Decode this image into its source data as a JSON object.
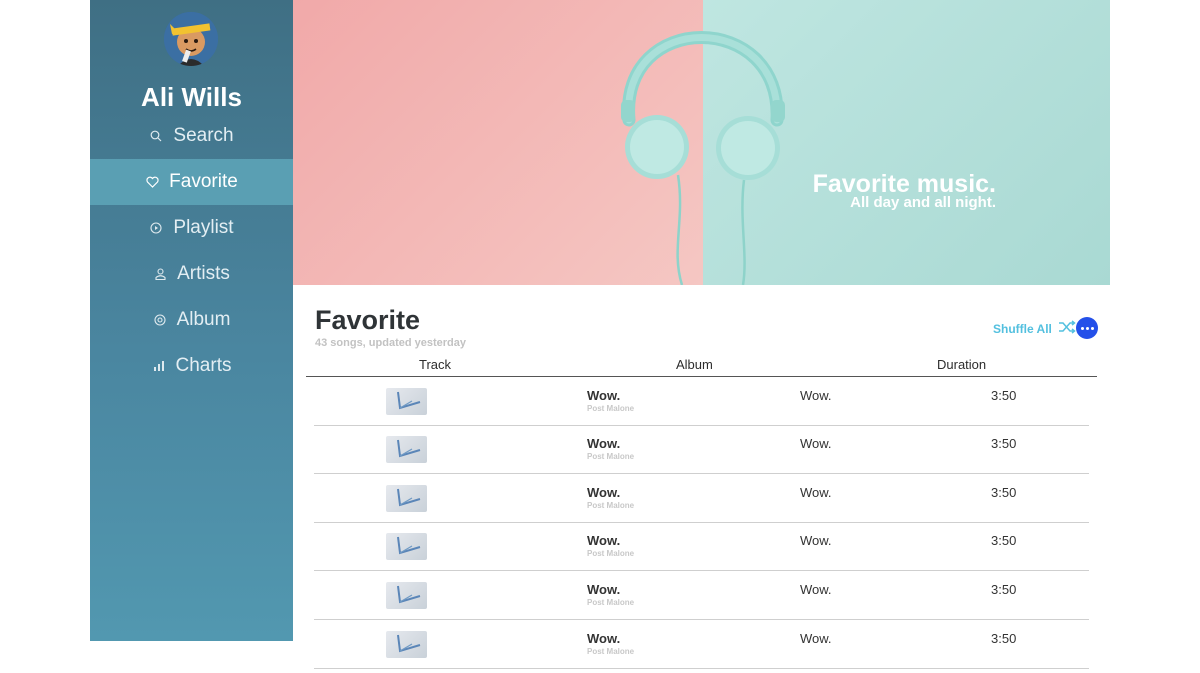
{
  "profile": {
    "name": "Ali Wills"
  },
  "nav": [
    {
      "label": "Search",
      "icon": "search-icon",
      "active": false
    },
    {
      "label": "Favorite",
      "icon": "heart-icon",
      "active": true
    },
    {
      "label": "Playlist",
      "icon": "play-circle-icon",
      "active": false
    },
    {
      "label": "Artists",
      "icon": "person-icon",
      "active": false
    },
    {
      "label": "Album",
      "icon": "disc-icon",
      "active": false
    },
    {
      "label": "Charts",
      "icon": "bar-chart-icon",
      "active": false
    }
  ],
  "hero": {
    "title": "Favorite music.",
    "subtitle": "All day and all night."
  },
  "section": {
    "title": "Favorite",
    "subtitle": "43 songs, updated yesterday"
  },
  "actions": {
    "shuffle_label": "Shuffle All"
  },
  "table": {
    "headers": {
      "track": "Track",
      "album": "Album",
      "duration": "Duration"
    },
    "rows": [
      {
        "title": "Wow.",
        "artist": "Post Malone",
        "album": "Wow.",
        "duration": "3:50"
      },
      {
        "title": "Wow.",
        "artist": "Post Malone",
        "album": "Wow.",
        "duration": "3:50"
      },
      {
        "title": "Wow.",
        "artist": "Post Malone",
        "album": "Wow.",
        "duration": "3:50"
      },
      {
        "title": "Wow.",
        "artist": "Post Malone",
        "album": "Wow.",
        "duration": "3:50"
      },
      {
        "title": "Wow.",
        "artist": "Post Malone",
        "album": "Wow.",
        "duration": "3:50"
      },
      {
        "title": "Wow.",
        "artist": "Post Malone",
        "album": "Wow.",
        "duration": "3:50"
      }
    ]
  },
  "colors": {
    "accent": "#53c0df",
    "more_button": "#2450e9",
    "sidebar": "#4a86a0"
  }
}
